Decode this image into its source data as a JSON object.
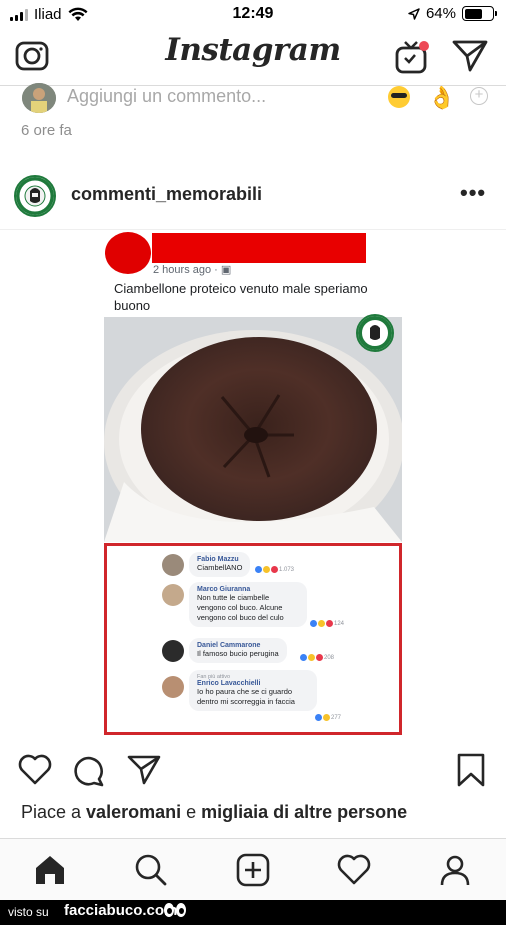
{
  "status_bar": {
    "carrier": "Iliad",
    "time": "12:49",
    "battery_percent": "64%",
    "battery_level": 0.64
  },
  "header": {
    "app_title": "Instagram",
    "icons": [
      "camera-icon",
      "igtv-icon",
      "direct-message-icon"
    ]
  },
  "comment_bar": {
    "placeholder": "Aggiungi un commento...",
    "quick_emojis": [
      "sunglasses-emoji",
      "ok-hand-emoji",
      "add-emoji-icon"
    ]
  },
  "previous_post": {
    "time_ago": "6 ore fa"
  },
  "post": {
    "username": "commenti_memorabili",
    "more_label": "•••",
    "embedded_facebook_post": {
      "meta": "2 hours ago · ▣",
      "caption": "Ciambellone proteico venuto male speriamo buono",
      "comments": [
        {
          "name": "Fabio Mazzu",
          "fan_badge": "",
          "text": "CiambellANO",
          "reactions": "1.073"
        },
        {
          "name": "Marco Giuranna",
          "fan_badge": "",
          "text": "Non tutte le ciambelle vengono col buco. Alcune vengono col buco del culo",
          "reactions": "124"
        },
        {
          "name": "Daniel Cammarone",
          "fan_badge": "",
          "text": "Il famoso bucio perugina",
          "reactions": "208"
        },
        {
          "name": "Enrico Lavacchielli",
          "fan_badge": "Fan più attivo",
          "text": "Io ho paura che se ci guardo dentro mi scorreggia in faccia",
          "reactions": "277"
        }
      ]
    },
    "likes_text": {
      "prefix": "Piace a ",
      "user": "valeromani",
      "middle": " e ",
      "others": "migliaia di altre persone"
    }
  },
  "bottom_nav": [
    "home-icon",
    "search-icon",
    "new-post-icon",
    "activity-heart-icon",
    "profile-icon"
  ],
  "footer": {
    "visto_su": "visto su",
    "site": "facciabuco.com"
  }
}
